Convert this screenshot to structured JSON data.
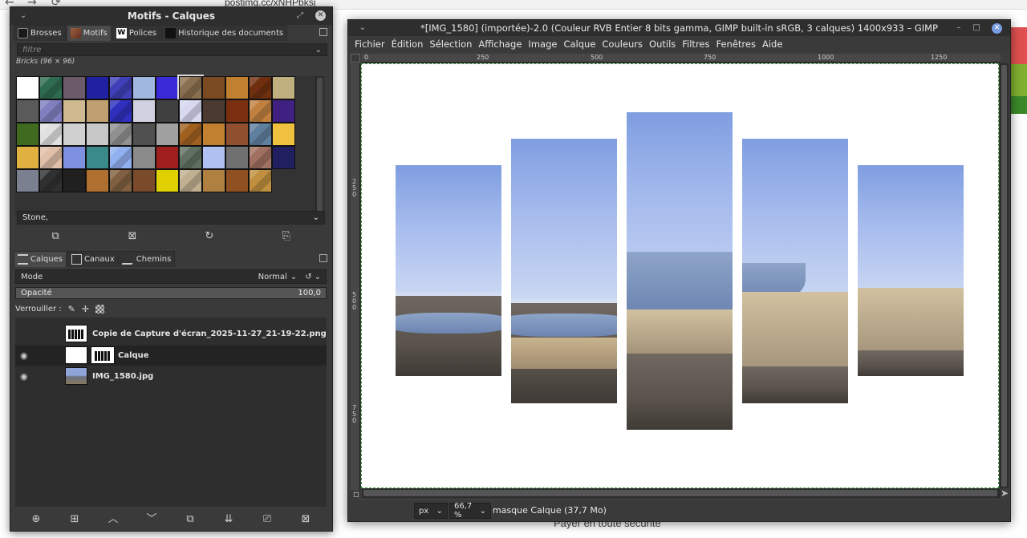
{
  "browser": {
    "back": "←",
    "forward": "→",
    "reload": "⟳",
    "url": "postimg.cc/xNHPbksj",
    "footer_text": "Payer en toute sécurité"
  },
  "dock": {
    "title": "Motifs - Calques",
    "top_tabs": [
      {
        "label": "Brosses",
        "icon": "brush-icon"
      },
      {
        "label": "Motifs",
        "icon": "pattern-icon"
      },
      {
        "label": "Polices",
        "icon": "font-icon"
      },
      {
        "label": "Historique des documents",
        "icon": "history-icon"
      }
    ],
    "filter_placeholder": "filtre",
    "pattern_set_label": "Bricks (96 × 96)",
    "selected_pattern": "Stone,",
    "patterns": [
      "#ffffff",
      "#2f6b50",
      "#6a5a6a",
      "#2020a0",
      "#4040b8",
      "#a0b8e0",
      "#3a2ad8",
      "#8a7050",
      "#7a4a20",
      "#c08030",
      "#703010",
      "#c0b080",
      "#5a5a5a",
      "#8080c0",
      "#d0b890",
      "#c0a070",
      "#3030c0",
      "#d0d0e0",
      "#404040",
      "#d8d8f0",
      "#4a3a30",
      "#7a3010",
      "#c08040",
      "#402080",
      "#406a20",
      "#e0e0e0",
      "#d0d0d0",
      "#c8c8c8",
      "#909090",
      "#505050",
      "#a0a0a0",
      "#a06020",
      "#c08030",
      "#905030",
      "#6080a0",
      "#f0c040",
      "#e0b040",
      "#e0c0a8",
      "#8090e0",
      "#3a8a8a",
      "#90b0f0",
      "#8a8a8a",
      "#a02020",
      "#607060",
      "#b0c0f0",
      "#707070",
      "#a07060",
      "#202060",
      "#7a8090",
      "#303030",
      "#202020",
      "#b07030",
      "#806040",
      "#7a4a2a",
      "#e0d000",
      "#c0b090",
      "#b08040",
      "#905020",
      "#c09040"
    ],
    "bottom_tools_top": [
      "edit-pattern-icon",
      "delete-pattern-icon",
      "refresh-icon",
      "open-folder-icon"
    ],
    "layer_tabs": [
      {
        "label": "Calques",
        "icon": "layers-icon"
      },
      {
        "label": "Canaux",
        "icon": "channels-icon"
      },
      {
        "label": "Chemins",
        "icon": "paths-icon"
      }
    ],
    "mode_label": "Mode",
    "mode_value": "Normal",
    "opacity_label": "Opacité",
    "opacity_value": "100,0",
    "lock_label": "Verrouiller :",
    "layers": [
      {
        "name": "Copie de Capture d'écran_2025-11-27_21-19-22.png",
        "visible": false,
        "selected": false,
        "mask": false
      },
      {
        "name": "Calque",
        "visible": true,
        "selected": true,
        "mask": true
      },
      {
        "name": "IMG_1580.jpg",
        "visible": true,
        "selected": false,
        "mask": false
      }
    ]
  },
  "image_window": {
    "title": "*[IMG_1580] (importée)-2.0 (Couleur RVB Entier 8 bits gamma, GIMP built-in sRGB, 3 calques) 1400x933 – GIMP",
    "menu": [
      "Fichier",
      "Édition",
      "Sélection",
      "Affichage",
      "Image",
      "Calque",
      "Couleurs",
      "Outils",
      "Filtres",
      "Fenêtres",
      "Aide"
    ],
    "ruler_h": [
      "0",
      "250",
      "500",
      "750",
      "1000",
      "1250"
    ],
    "ruler_v": [
      "250",
      "500",
      "750"
    ],
    "unit": "px",
    "zoom": "66,7 %",
    "status": "masque Calque (37,7 Mo)"
  },
  "colors": {
    "accent_green": "#3a9a3a",
    "dock_bg": "#3a3a3a",
    "titlebar_bg": "#2e2e2e"
  }
}
